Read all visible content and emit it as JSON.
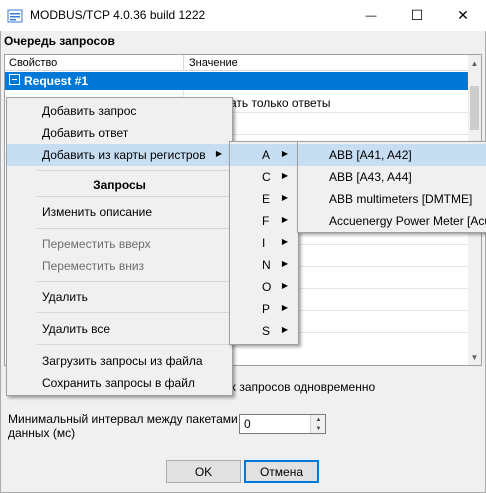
{
  "window": {
    "title": "MODBUS/TCP 4.0.36 build 1222",
    "minimize_glyph": "—",
    "maximize_glyph": "☐",
    "close_glyph": "✕"
  },
  "group_title": "Очередь запросов",
  "grid": {
    "columns": [
      "Свойство",
      "Значение"
    ],
    "request_label": "Request #1",
    "row1_value_partial": "ать только ответы"
  },
  "hidden_checkbox_label_partial": "х запросов одновременно",
  "min_interval": {
    "label": "Минимальный интервал между пакетами данных (мс)",
    "value": "0"
  },
  "buttons": {
    "ok": "OK",
    "cancel": "Отмена"
  },
  "context_menu": {
    "add_request": "Добавить запрос",
    "add_response": "Добавить ответ",
    "add_from_register_map": "Добавить из карты регистров",
    "header_requests": "Запросы",
    "edit_description": "Изменить описание",
    "move_up": "Переместить вверх",
    "move_down": "Переместить вниз",
    "delete": "Удалить",
    "delete_all": "Удалить все",
    "load_from_file": "Загрузить запросы из файла",
    "save_to_file": "Сохранить запросы в файл"
  },
  "letters_submenu": [
    "A",
    "C",
    "E",
    "F",
    "I",
    "N",
    "O",
    "P",
    "S"
  ],
  "devices_submenu": [
    "ABB [A41, A42]",
    "ABB [A43, A44]",
    "ABB multimeters [DMTME]",
    "Accuenergy Power Meter [Acu"
  ],
  "colors": {
    "selection_blue": "#0078d7",
    "menu_highlight": "#c7ddf2",
    "menu_bg": "#f0f0f0"
  }
}
